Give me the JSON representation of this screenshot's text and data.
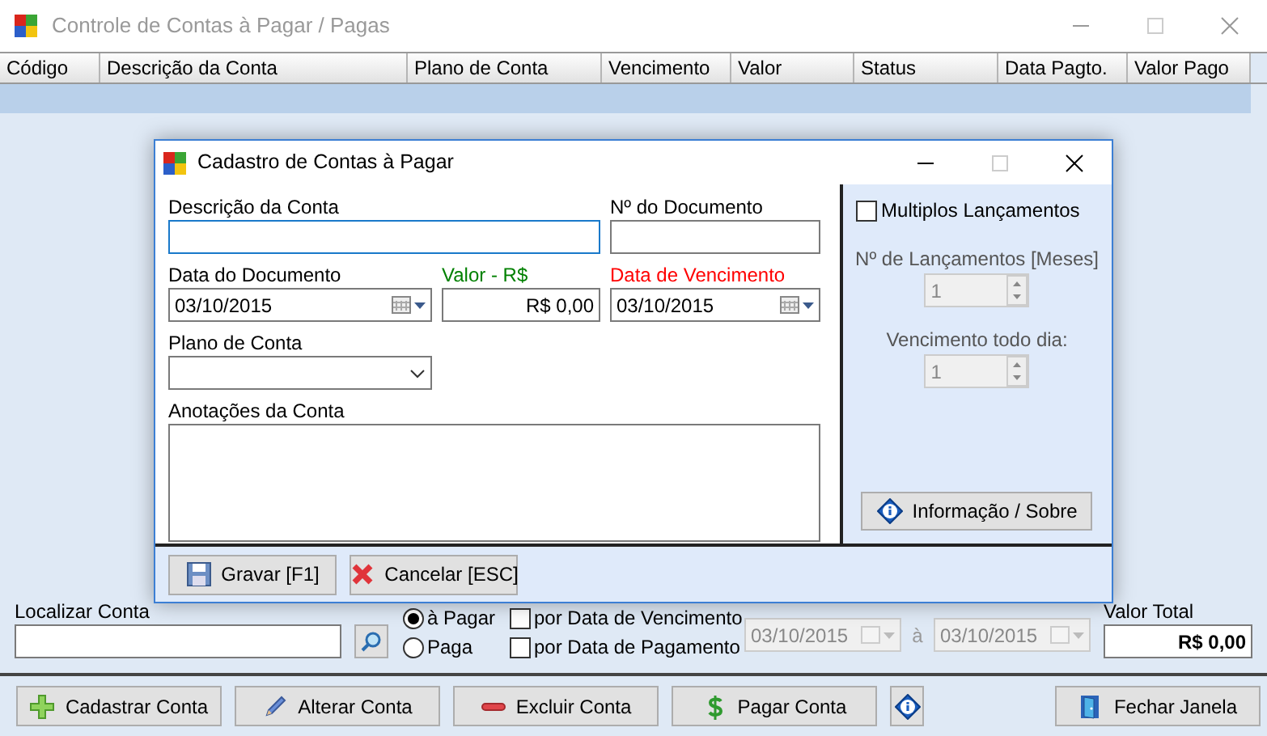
{
  "window": {
    "title": "Controle de Contas à Pagar / Pagas"
  },
  "grid": {
    "columns": [
      "Código",
      "Descrição da Conta",
      "Plano de Conta",
      "Vencimento",
      "Valor",
      "Status",
      "Data Pagto.",
      "Valor Pago"
    ],
    "rows": [
      {
        "selected": true
      }
    ]
  },
  "filter": {
    "search_label": "Localizar Conta",
    "status_options": [
      {
        "label": "à Pagar",
        "selected": true
      },
      {
        "label": "Paga",
        "selected": false
      }
    ],
    "date_options": [
      {
        "label": "por Data de Vencimento",
        "checked": false
      },
      {
        "label": "por Data de Pagamento",
        "checked": false
      }
    ],
    "date_from": {
      "value": "03/10/2015",
      "disabled": true
    },
    "range_separator": "à",
    "date_to": {
      "value": "03/10/2015",
      "disabled": true
    },
    "total_label": "Valor Total",
    "total_value": "R$ 0,00"
  },
  "buttons": [
    {
      "kind": "plus",
      "label": "Cadastrar Conta"
    },
    {
      "kind": "pencil",
      "label": "Alterar Conta"
    },
    {
      "kind": "minus",
      "label": "Excluir Conta"
    },
    {
      "kind": "money",
      "label": "Pagar Conta"
    },
    {
      "kind": "info"
    },
    {
      "kind": "door",
      "label": "Fechar Janela"
    }
  ],
  "dialog": {
    "title": "Cadastro de Contas à Pagar",
    "fields": [
      {
        "kind": "text",
        "label": "Descrição da Conta",
        "color": "#000000",
        "focused": true
      },
      {
        "kind": "text",
        "label": "Nº do Documento",
        "color": "#000000",
        "focused": false
      },
      {
        "kind": "date",
        "label": "Data do Documento",
        "color": "#000000",
        "value": "03/10/2015"
      },
      {
        "kind": "money",
        "label": "Valor - R$",
        "color": "#008000",
        "value": "R$ 0,00"
      },
      {
        "kind": "date",
        "label": "Data de Vencimento",
        "color": "#ff0000",
        "value": "03/10/2015"
      },
      {
        "kind": "select",
        "label": "Plano de Conta",
        "color": "#000000"
      },
      {
        "kind": "memo",
        "label": "Anotações da Conta",
        "color": "#000000"
      }
    ],
    "multiple": {
      "label": "Multiplos Lançamentos",
      "checked": false
    },
    "spinners": [
      {
        "label": "Nº de Lançamentos [Meses]",
        "value": "1",
        "disabled": true
      },
      {
        "label": "Vencimento todo dia:",
        "value": "1",
        "disabled": true
      }
    ],
    "info_button": "Informação / Sobre",
    "footer_buttons": [
      {
        "kind": "save",
        "label": "Gravar [F1]"
      },
      {
        "kind": "cancel",
        "label": "Cancelar [ESC]"
      }
    ]
  }
}
